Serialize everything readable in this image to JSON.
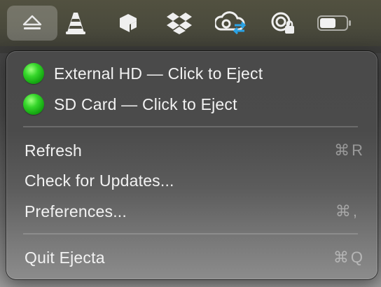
{
  "menubar": {
    "icons": [
      {
        "name": "eject-icon",
        "active": true
      },
      {
        "name": "vlc-cone-icon",
        "active": false
      },
      {
        "name": "app-cube-icon",
        "active": false
      },
      {
        "name": "dropbox-icon",
        "active": false
      },
      {
        "name": "creative-cloud-sync-icon",
        "active": false
      },
      {
        "name": "lock-status-icon",
        "active": false
      },
      {
        "name": "battery-icon",
        "active": false
      }
    ]
  },
  "menu": {
    "drives": [
      {
        "label": "External HD — Click to Eject",
        "status_color": "#1fb81a"
      },
      {
        "label": "SD Card — Click to Eject",
        "status_color": "#1fb81a"
      }
    ],
    "refresh": {
      "label": "Refresh",
      "shortcut": "⌘R"
    },
    "check_updates": {
      "label": "Check for Updates..."
    },
    "preferences": {
      "label": "Preferences...",
      "shortcut": "⌘,"
    },
    "quit": {
      "label": "Quit Ejecta",
      "shortcut": "⌘Q"
    }
  }
}
